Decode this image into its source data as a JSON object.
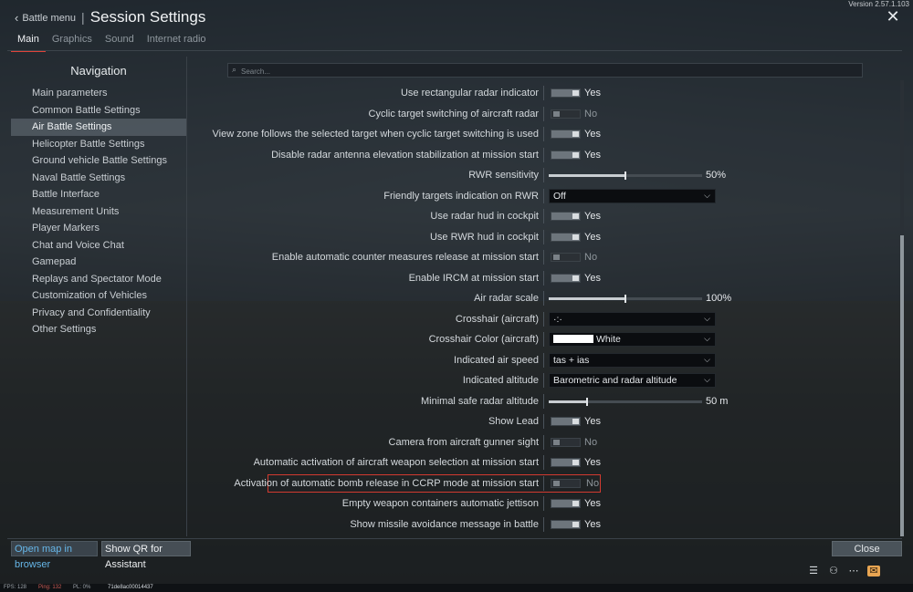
{
  "window": {
    "version": "Version 2.57.1.103",
    "back_label": "Battle menu",
    "separator": "|",
    "title": "Session Settings"
  },
  "tabs": [
    {
      "label": "Main",
      "active": true
    },
    {
      "label": "Graphics",
      "active": false
    },
    {
      "label": "Sound",
      "active": false
    },
    {
      "label": "Internet radio",
      "active": false
    }
  ],
  "nav": {
    "title": "Navigation",
    "items": [
      {
        "label": "Main parameters"
      },
      {
        "label": "Common Battle Settings"
      },
      {
        "label": "Air Battle Settings",
        "active": true
      },
      {
        "label": "Helicopter Battle Settings"
      },
      {
        "label": "Ground vehicle Battle Settings"
      },
      {
        "label": "Naval Battle Settings"
      },
      {
        "label": "Battle Interface"
      },
      {
        "label": "Measurement Units"
      },
      {
        "label": "Player Markers"
      },
      {
        "label": "Chat and Voice Chat"
      },
      {
        "label": "Gamepad"
      },
      {
        "label": "Replays and Spectator Mode"
      },
      {
        "label": "Customization of Vehicles"
      },
      {
        "label": "Privacy and Confidentiality"
      },
      {
        "label": "Other Settings"
      }
    ]
  },
  "search": {
    "placeholder": "Search..."
  },
  "settings": [
    {
      "label": "Use rectangular radar indicator",
      "kind": "toggle",
      "on": true,
      "value": "Yes"
    },
    {
      "label": "Cyclic target switching of aircraft radar",
      "kind": "toggle",
      "on": false,
      "value": "No"
    },
    {
      "label": "View zone follows the selected target when cyclic target switching is used",
      "kind": "toggle",
      "on": true,
      "value": "Yes"
    },
    {
      "label": "Disable radar antenna elevation stabilization at mission start",
      "kind": "toggle",
      "on": true,
      "value": "Yes"
    },
    {
      "label": "RWR sensitivity",
      "kind": "slider",
      "fraction": 0.5,
      "value": "50%"
    },
    {
      "label": "Friendly targets indication on RWR",
      "kind": "select",
      "value": "Off"
    },
    {
      "label": "Use radar hud in cockpit",
      "kind": "toggle",
      "on": true,
      "value": "Yes"
    },
    {
      "label": "Use RWR hud in cockpit",
      "kind": "toggle",
      "on": true,
      "value": "Yes"
    },
    {
      "label": "Enable automatic counter measures release at mission start",
      "kind": "toggle",
      "on": false,
      "value": "No"
    },
    {
      "label": "Enable IRCM at mission start",
      "kind": "toggle",
      "on": true,
      "value": "Yes"
    },
    {
      "label": "Air radar scale",
      "kind": "slider",
      "fraction": 0.5,
      "value": "100%"
    },
    {
      "label": "Crosshair (aircraft)",
      "kind": "select",
      "value": "·:·"
    },
    {
      "label": "Crosshair Color (aircraft)",
      "kind": "select",
      "value": "White",
      "swatch": "#ffffff"
    },
    {
      "label": "Indicated air speed",
      "kind": "select",
      "value": "tas + ias"
    },
    {
      "label": "Indicated altitude",
      "kind": "select",
      "value": "Barometric and radar altitude"
    },
    {
      "label": "Minimal safe radar altitude",
      "kind": "slider",
      "fraction": 0.25,
      "value": "50 m"
    },
    {
      "label": "Show Lead",
      "kind": "toggle",
      "on": true,
      "value": "Yes"
    },
    {
      "label": "Camera from aircraft gunner sight",
      "kind": "toggle",
      "on": false,
      "value": "No"
    },
    {
      "label": "Automatic activation of aircraft weapon selection at mission start",
      "kind": "toggle",
      "on": true,
      "value": "Yes"
    },
    {
      "label": "Activation of automatic bomb release in CCRP mode at mission start",
      "kind": "toggle",
      "on": false,
      "value": "No",
      "highlight": true
    },
    {
      "label": "Empty weapon containers automatic jettison",
      "kind": "toggle",
      "on": true,
      "value": "Yes"
    },
    {
      "label": "Show missile avoidance message in battle",
      "kind": "toggle",
      "on": true,
      "value": "Yes"
    }
  ],
  "footer": {
    "open_map": "Open map in browser",
    "show_qr": "Show QR for Assistant",
    "close": "Close"
  },
  "status": {
    "fps": "FPS: 128",
    "ping": "Ping: 132",
    "pl": "PL: 0%",
    "session": "71de8ac00014437"
  },
  "colors": {
    "accent_tab": "#e0433a",
    "highlight_box": "#d23a30",
    "link_blue": "#66b6e8",
    "mail_icon": "#e8a552"
  },
  "icons": [
    "list-icon",
    "squad-icon",
    "chat-icon",
    "mail-icon"
  ]
}
